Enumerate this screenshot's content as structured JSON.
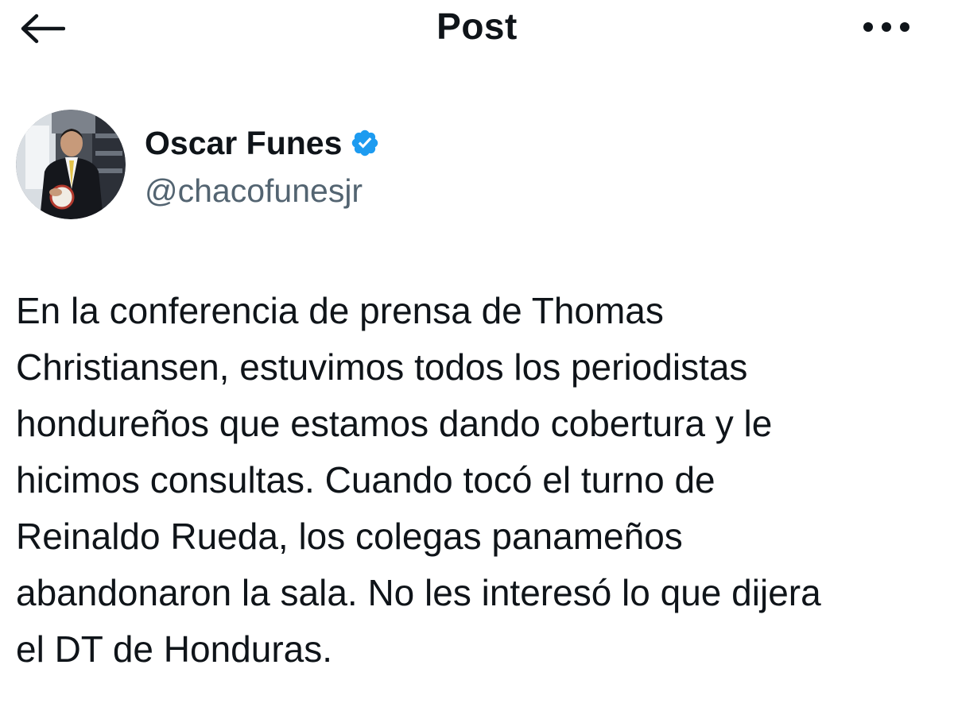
{
  "header": {
    "title": "Post",
    "back_icon": "arrow-left-icon",
    "more_icon": "more-horizontal-icon"
  },
  "author": {
    "display_name": "Oscar Funes",
    "handle": "@chacofunesjr",
    "verified": true,
    "verified_color": "#1d9bf0"
  },
  "post": {
    "text": "En la conferencia de prensa de Thomas\nChristiansen, estuvimos todos los periodistas\nhondureños que estamos dando cobertura y le\nhicimos consultas. Cuando tocó el turno de\nReinaldo Rueda, los colegas panameños\nabandonaron la sala. No les interesó lo que dijera\nel DT de Honduras."
  },
  "colors": {
    "text": "#0f1419",
    "secondary_text": "#536471",
    "background": "#ffffff",
    "accent": "#1d9bf0"
  }
}
